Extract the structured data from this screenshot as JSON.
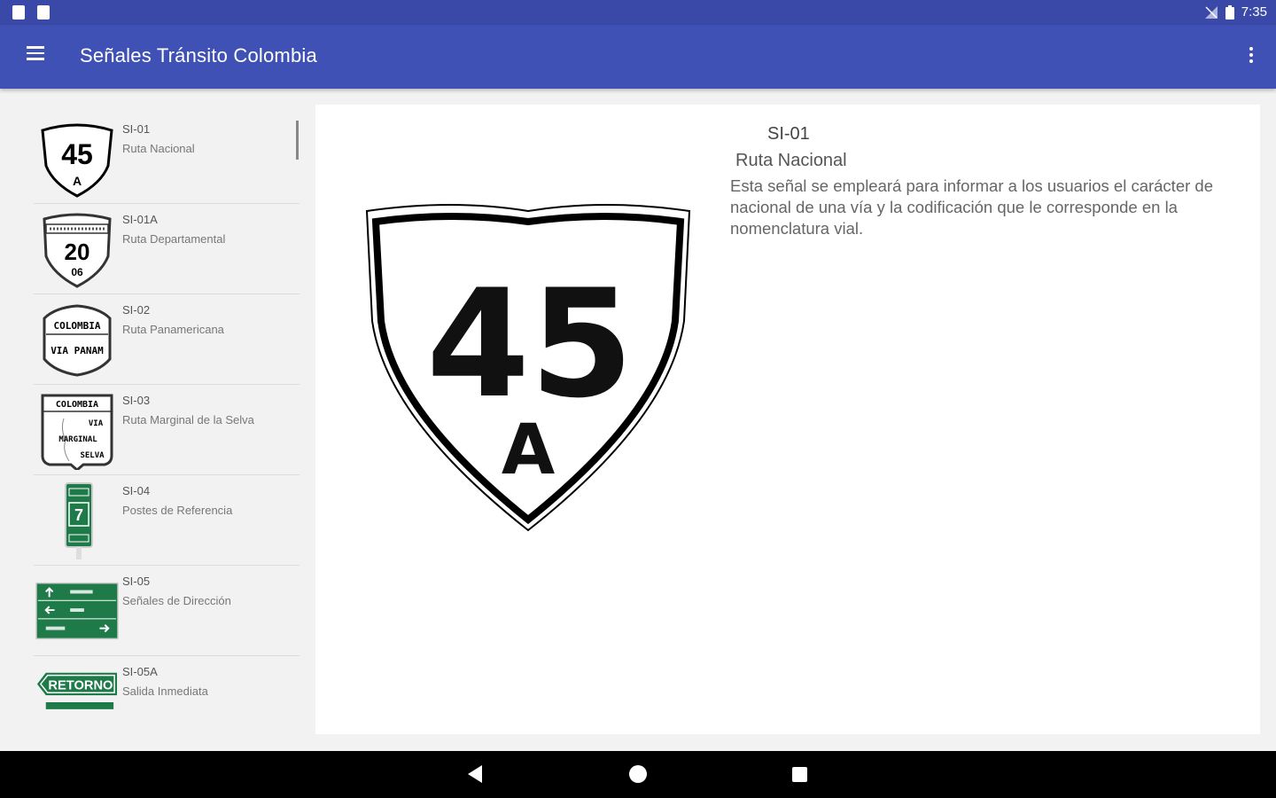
{
  "status_bar": {
    "time": "7:35"
  },
  "app_bar": {
    "title": "Señales Tránsito Colombia"
  },
  "signals": [
    {
      "code": "SI-01",
      "name": "Ruta Nacional",
      "icon": "shield-45-a-icon",
      "sign_text": [
        "45",
        "A"
      ]
    },
    {
      "code": "SI-01A",
      "name": "Ruta Departamental",
      "icon": "shield-department-route-icon",
      "sign_text": [
        "20",
        "06"
      ]
    },
    {
      "code": "SI-02",
      "name": "Ruta Panamericana",
      "icon": "panamerican-route-icon",
      "sign_text": [
        "COLOMBIA",
        "VIA PANAM"
      ]
    },
    {
      "code": "SI-03",
      "name": "Ruta Marginal de la Selva",
      "icon": "jungle-marginal-route-icon",
      "sign_text": [
        "COLOMBIA",
        "VIA",
        "MARGINAL",
        "SELVA"
      ]
    },
    {
      "code": "SI-04",
      "name": "Postes de Referencia",
      "icon": "reference-post-icon",
      "sign_text": [
        "7"
      ]
    },
    {
      "code": "SI-05",
      "name": "Señales de Dirección",
      "icon": "direction-signs-icon",
      "sign_text": []
    },
    {
      "code": "SI-05A",
      "name": "Salida Inmediata",
      "icon": "return-exit-icon",
      "sign_text": [
        "RETORNO"
      ]
    }
  ],
  "detail": {
    "code": "SI-01",
    "name": "Ruta Nacional",
    "description": "Esta señal se empleará para informar a los usuarios el carácter de nacional de una vía y la codificación que le corresponde en la nomenclatura vial.",
    "sign_number": "45",
    "sign_letter": "A"
  },
  "colors": {
    "primary": "#3f51b5",
    "status_bar": "#3a48a8",
    "sign_green": "#1f7a4a"
  }
}
